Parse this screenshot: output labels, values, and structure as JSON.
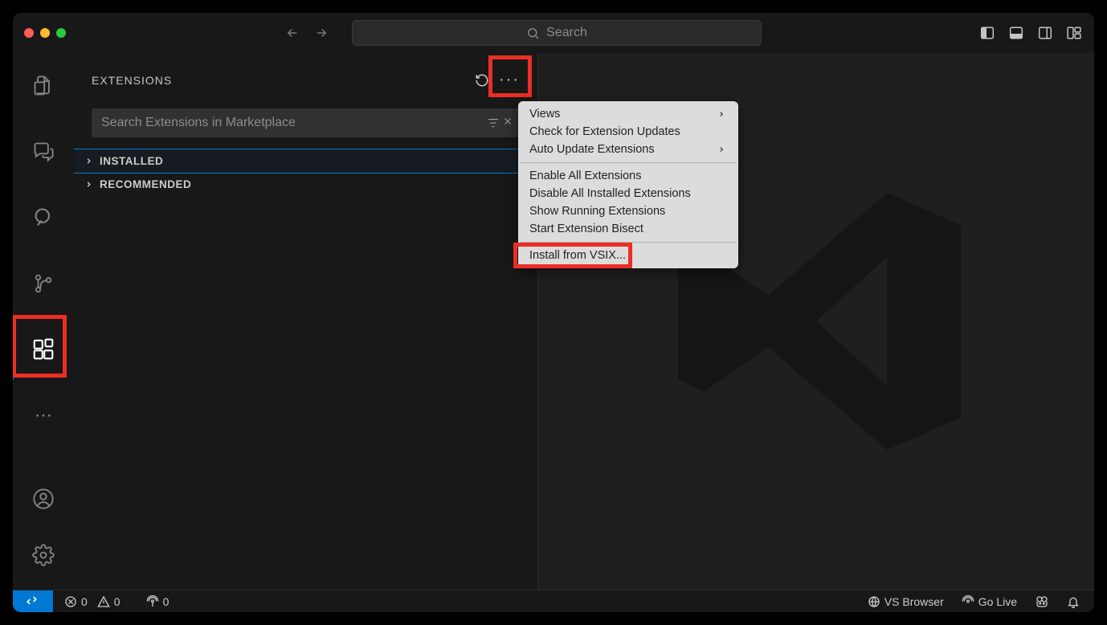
{
  "titlebar": {
    "search_placeholder": "Search"
  },
  "sidebar": {
    "title": "EXTENSIONS",
    "search_placeholder": "Search Extensions in Marketplace",
    "sections": {
      "installed": "INSTALLED",
      "recommended": "RECOMMENDED"
    }
  },
  "context_menu": {
    "views": "Views",
    "check_updates": "Check for Extension Updates",
    "auto_update": "Auto Update Extensions",
    "enable_all": "Enable All Extensions",
    "disable_all": "Disable All Installed Extensions",
    "show_running": "Show Running Extensions",
    "start_bisect": "Start Extension Bisect",
    "install_vsix": "Install from VSIX..."
  },
  "status": {
    "errors": "0",
    "warnings": "0",
    "ports": "0",
    "vs_browser": "VS Browser",
    "go_live": "Go Live"
  }
}
